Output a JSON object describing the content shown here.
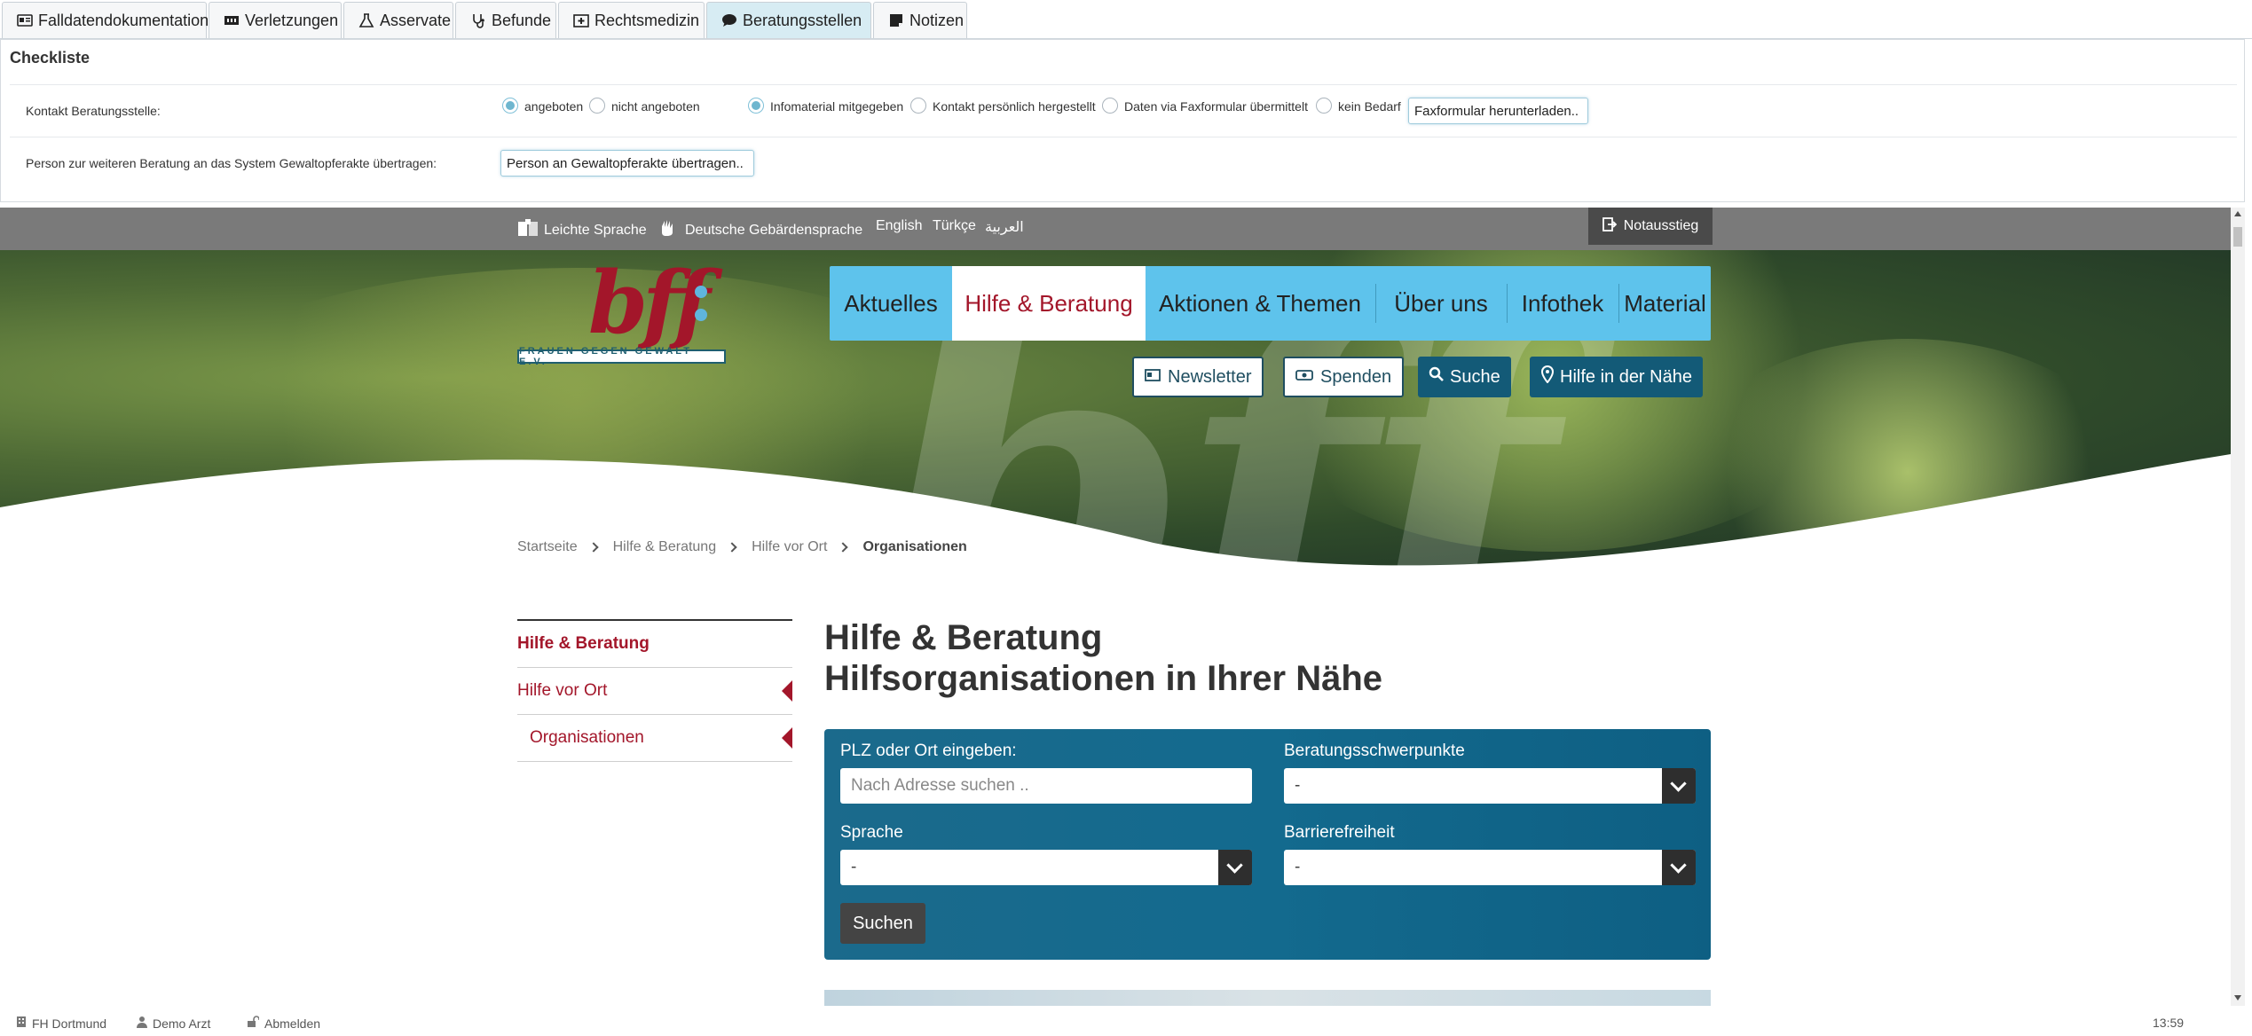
{
  "tabs": [
    {
      "label": "Falldatendokumentation",
      "icon": "id-card-icon"
    },
    {
      "label": "Verletzungen",
      "icon": "injury-icon"
    },
    {
      "label": "Asservate",
      "icon": "flask-icon"
    },
    {
      "label": "Befunde",
      "icon": "stethoscope-icon"
    },
    {
      "label": "Rechtsmedizin",
      "icon": "medical-kit-icon"
    },
    {
      "label": "Beratungsstellen",
      "icon": "chat-icon",
      "active": true
    },
    {
      "label": "Notizen",
      "icon": "note-icon"
    }
  ],
  "checklist": {
    "title": "Checkliste",
    "row1_label": "Kontakt Beratungsstelle:",
    "opt_angeboten": "angeboten",
    "opt_nicht_angeboten": "nicht angeboten",
    "opt_infomaterial": "Infomaterial mitgegeben",
    "opt_kontakt": "Kontakt persönlich hergestellt",
    "opt_fax": "Daten via Faxformular übermittelt",
    "opt_kein_bedarf": "kein Bedarf",
    "fax_button": "Faxformular herunterladen..",
    "row2_label": "Person zur weiteren Beratung an das System Gewaltopferakte übertragen:",
    "transfer_button": "Person an Gewaltopferakte übertragen.."
  },
  "site": {
    "lang_links": [
      "Leichte Sprache",
      "Deutsche Gebärdensprache",
      "English",
      "Türkçe",
      "العربية"
    ],
    "notausstieg": "Notausstieg",
    "logo_text": "bff",
    "logo_sub": "FRAUEN GEGEN GEWALT E.V.",
    "nav": [
      "Aktuelles",
      "Hilfe & Beratung",
      "Aktionen & Themen",
      "Über uns",
      "Infothek",
      "Material"
    ],
    "nav_active": "Hilfe & Beratung",
    "actions": {
      "newsletter": "Newsletter",
      "spenden": "Spenden",
      "suche": "Suche",
      "hilfe": "Hilfe in der Nähe"
    },
    "breadcrumb": [
      "Startseite",
      "Hilfe & Beratung",
      "Hilfe vor Ort",
      "Organisationen"
    ],
    "sidenav": [
      "Hilfe & Beratung",
      "Hilfe vor Ort",
      "Organisationen"
    ],
    "title_line1": "Hilfe & Beratung",
    "title_line2": "Hilfsorganisationen in Ihrer Nähe",
    "form": {
      "plz_label": "PLZ oder Ort eingeben:",
      "plz_placeholder": "Nach Adresse suchen ..",
      "schwerpunkte_label": "Beratungsschwerpunkte",
      "schwerpunkte_value": "-",
      "sprache_label": "Sprache",
      "sprache_value": "-",
      "barriere_label": "Barrierefreiheit",
      "barriere_value": "-",
      "submit": "Suchen"
    }
  },
  "status": {
    "org": "FH Dortmund",
    "user": "Demo Arzt",
    "logout": "Abmelden",
    "time": "13:59"
  },
  "colors": {
    "accent_red": "#a3162a",
    "nav_blue": "#5ec3ec",
    "search_blue": "#136a8e",
    "active_tab": "#d7ecf3"
  }
}
